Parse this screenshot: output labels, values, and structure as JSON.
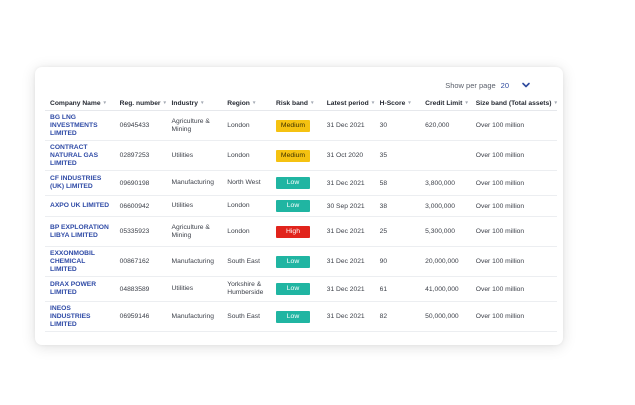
{
  "pagination": {
    "label": "Show per page",
    "value": "20"
  },
  "columns": [
    "Company Name",
    "Reg. number",
    "Industry",
    "Region",
    "Risk band",
    "Latest period",
    "H-Score",
    "Credit Limit",
    "Size band (Total assets)"
  ],
  "rows": [
    {
      "company": "BG LNG INVESTMENTS LIMITED",
      "reg": "06945433",
      "industry": "Agriculture & Mining",
      "region": "London",
      "risk": "Medium",
      "period": "31 Dec 2021",
      "hscore": "30",
      "credit": "620,000",
      "size": "Over 100 million"
    },
    {
      "company": "CONTRACT NATURAL GAS LIMITED",
      "reg": "02897253",
      "industry": "Utilities",
      "region": "London",
      "risk": "Medium",
      "period": "31 Oct 2020",
      "hscore": "35",
      "credit": "",
      "size": "Over 100 million"
    },
    {
      "company": "CF INDUSTRIES (UK) LIMITED",
      "reg": "09690198",
      "industry": "Manufacturing",
      "region": "North West",
      "risk": "Low",
      "period": "31 Dec 2021",
      "hscore": "58",
      "credit": "3,800,000",
      "size": "Over 100 million"
    },
    {
      "company": "AXPO UK LIMITED",
      "reg": "06600942",
      "industry": "Utilities",
      "region": "London",
      "risk": "Low",
      "period": "30 Sep 2021",
      "hscore": "38",
      "credit": "3,000,000",
      "size": "Over 100 million"
    },
    {
      "company": "BP EXPLORATION LIBYA LIMITED",
      "reg": "05335923",
      "industry": "Agriculture & Mining",
      "region": "London",
      "risk": "High",
      "period": "31 Dec 2021",
      "hscore": "25",
      "credit": "5,300,000",
      "size": "Over 100 million"
    },
    {
      "company": "EXXONMOBIL CHEMICAL LIMITED",
      "reg": "00867162",
      "industry": "Manufacturing",
      "region": "South East",
      "risk": "Low",
      "period": "31 Dec 2021",
      "hscore": "90",
      "credit": "20,000,000",
      "size": "Over 100 million"
    },
    {
      "company": "DRAX POWER LIMITED",
      "reg": "04883589",
      "industry": "Utilities",
      "region": "Yorkshire & Humberside",
      "risk": "Low",
      "period": "31 Dec 2021",
      "hscore": "61",
      "credit": "41,000,000",
      "size": "Over 100 million"
    },
    {
      "company": "INEOS INDUSTRIES LIMITED",
      "reg": "06959146",
      "industry": "Manufacturing",
      "region": "South East",
      "risk": "Low",
      "period": "31 Dec 2021",
      "hscore": "82",
      "credit": "50,000,000",
      "size": "Over 100 million"
    }
  ],
  "colors": {
    "accent": "#2e4aa6",
    "medium": "#f5c211",
    "low": "#20b5a2",
    "high": "#e1241c"
  },
  "icons": {
    "per_page_toggle": "chevron-down-icon",
    "sort": "sort-arrows-icon"
  }
}
